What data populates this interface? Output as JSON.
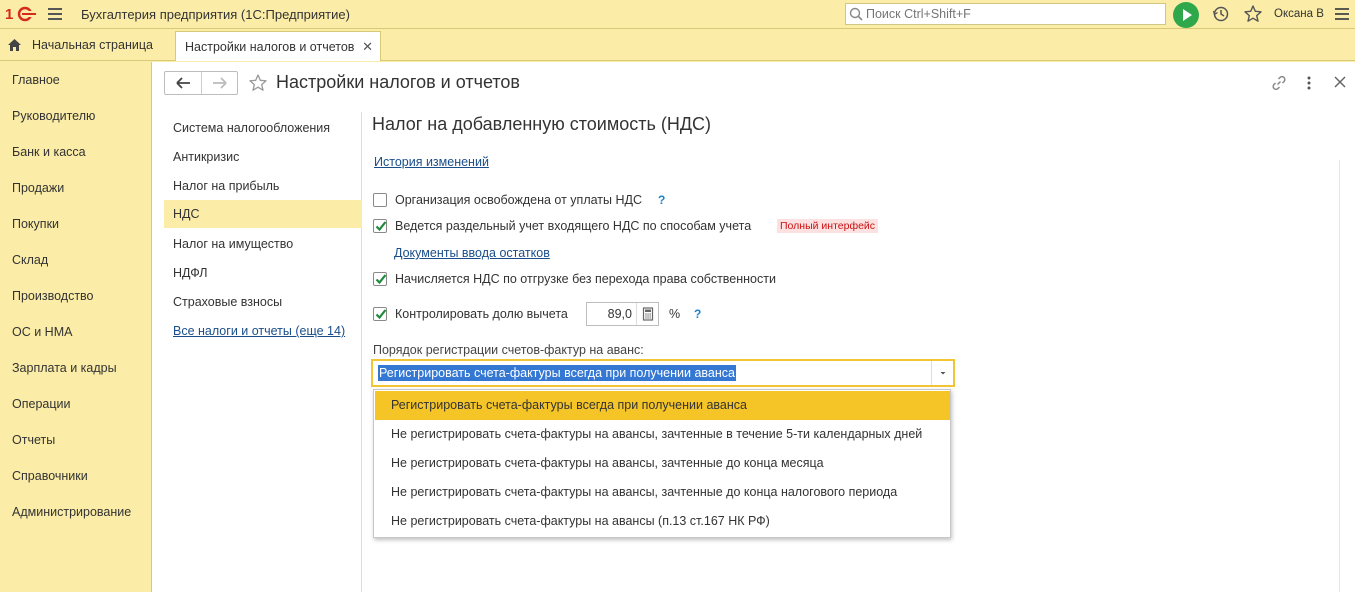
{
  "app": {
    "title": "Бухгалтерия предприятия  (1С:Предприятие)",
    "user": "Оксана В"
  },
  "search": {
    "placeholder": "Поиск Ctrl+Shift+F"
  },
  "tabs": {
    "home": "Начальная страница",
    "active": "Настройки налогов и отчетов"
  },
  "sidebar": {
    "items": [
      "Главное",
      "Руководителю",
      "Банк и касса",
      "Продажи",
      "Покупки",
      "Склад",
      "Производство",
      "ОС и НМА",
      "Зарплата и кадры",
      "Операции",
      "Отчеты",
      "Справочники",
      "Администрирование"
    ]
  },
  "page": {
    "title": "Настройки налогов и отчетов"
  },
  "sections": {
    "items": [
      "Система налогообложения",
      "Антикризис",
      "Налог на прибыль",
      "НДС",
      "Налог на имущество",
      "НДФЛ",
      "Страховые взносы",
      "Все налоги и отчеты (еще 14)"
    ],
    "active": "НДС"
  },
  "vat": {
    "title": "Налог на добавленную стоимость (НДС)",
    "history_link": "История изменений",
    "exempt_label": "Организация освобождена от уплаты НДС",
    "exempt_checked": false,
    "separate_label": "Ведется раздельный учет входящего НДС по способам учета",
    "separate_checked": true,
    "badge": "Полный интерфейс",
    "docs_link": "Документы ввода остатков",
    "shipment_label": "Начисляется НДС по отгрузке без перехода права собственности",
    "shipment_checked": true,
    "control_label": "Контролировать долю вычета",
    "control_checked": true,
    "deduction_value": "89,0",
    "percent": "%",
    "help": "?",
    "order_label": "Порядок регистрации счетов-фактур на аванс:",
    "order_value": "Регистрировать счета-фактуры всегда при получении аванса",
    "order_options": [
      "Регистрировать счета-фактуры всегда при получении аванса",
      "Не регистрировать счета-фактуры на авансы, зачтенные в течение 5-ти календарных дней",
      "Не регистрировать счета-фактуры на авансы, зачтенные до конца месяца",
      "Не регистрировать счета-фактуры на авансы, зачтенные до конца налогового периода",
      "Не регистрировать счета-фактуры на авансы (п.13 ст.167 НК РФ)"
    ]
  },
  "colors": {
    "chrome": "#fbeda7",
    "accent": "#f5c527",
    "link": "#1a4e8a",
    "help": "#1f82c9",
    "run_button": "#2ea84a"
  },
  "icons": {
    "logo": "1c-logo-icon",
    "menu": "hamburger-icon",
    "search": "search-icon",
    "run": "play-icon",
    "history": "history-icon",
    "favorites": "star-icon",
    "home": "home-icon",
    "back": "arrow-left-icon",
    "forward": "arrow-right-icon",
    "link": "link-icon",
    "more": "more-vertical-icon",
    "close": "close-icon",
    "calculator": "calculator-icon",
    "dropdown": "chevron-down-icon"
  }
}
